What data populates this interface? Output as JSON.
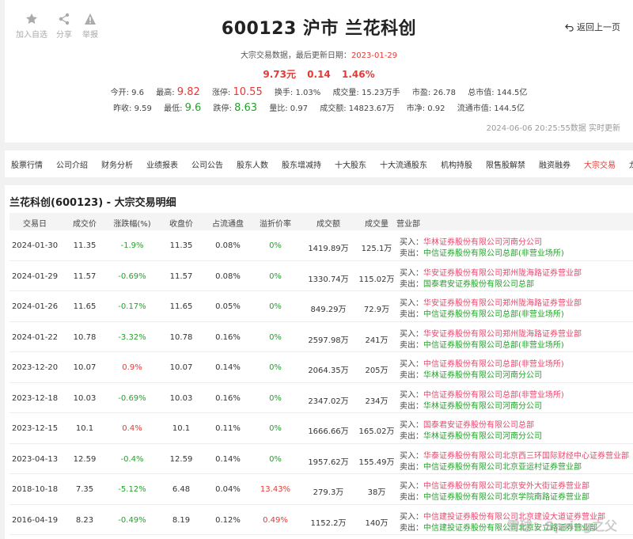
{
  "actions": [
    {
      "label": "加入自选",
      "icon": "star-icon"
    },
    {
      "label": "分享",
      "icon": "share-icon"
    },
    {
      "label": "举报",
      "icon": "warning-icon"
    }
  ],
  "title": "600123 沪市 兰花科创",
  "back_label": "返回上一页",
  "subtitle_prefix": "大宗交易数据，最后更新日期：",
  "subtitle_date": "2023-01-29",
  "price": {
    "last": "9.73元",
    "change": "0.14",
    "pct": "1.46%"
  },
  "stats_row1": [
    {
      "label": "今开:",
      "value": "9.6"
    },
    {
      "label": "最高:",
      "value": "9.82"
    },
    {
      "label": "涨停:",
      "value": "10.55"
    },
    {
      "label": "换手:",
      "value": "1.03%"
    },
    {
      "label": "成交量:",
      "value": "15.23万手"
    },
    {
      "label": "市盈:",
      "value": "26.78"
    },
    {
      "label": "总市值:",
      "value": "144.5亿"
    }
  ],
  "stats_row2": [
    {
      "label": "昨收:",
      "value": "9.59"
    },
    {
      "label": "最低:",
      "value": "9.6"
    },
    {
      "label": "跌停:",
      "value": "8.63"
    },
    {
      "label": "量比:",
      "value": "0.97"
    },
    {
      "label": "成交额:",
      "value": "14823.67万"
    },
    {
      "label": "市净:",
      "value": "0.92"
    },
    {
      "label": "流通市值:",
      "value": "144.5亿"
    }
  ],
  "updated": "2024-06-06 20:25:55数据 实时更新",
  "tabs": [
    "股票行情",
    "公司介绍",
    "财务分析",
    "业绩报表",
    "公司公告",
    "股东人数",
    "股东增减持",
    "十大股东",
    "十大流通股东",
    "机构持股",
    "限售股解禁",
    "融资融券",
    "大宗交易",
    "龙虎榜单"
  ],
  "active_tab": "大宗交易",
  "table_title": "兰花科创(600123) - 大宗交易明细",
  "columns": [
    "交易日",
    "成交价",
    "涨跌幅(%)",
    "收盘价",
    "占流通盘",
    "溢折价率",
    "成交额",
    "成交量",
    "营业部"
  ],
  "buy_label": "买入：",
  "sell_label": "卖出：",
  "rows": [
    {
      "date": "2024-01-30",
      "price": "11.35",
      "chg": "-1.9%",
      "close": "11.35",
      "float": "0.08%",
      "premium": "0%",
      "amount": "1419.89万",
      "volume": "125.1万",
      "buyer": "华林证券股份有限公司河南分公司",
      "seller": "中信证券股份有限公司总部(非营业场所)"
    },
    {
      "date": "2024-01-29",
      "price": "11.57",
      "chg": "-0.69%",
      "close": "11.57",
      "float": "0.08%",
      "premium": "0%",
      "amount": "1330.74万",
      "volume": "115.02万",
      "buyer": "华安证券股份有限公司郑州陇海路证券营业部",
      "seller": "国泰君安证券股份有限公司总部"
    },
    {
      "date": "2024-01-26",
      "price": "11.65",
      "chg": "-0.17%",
      "close": "11.65",
      "float": "0.05%",
      "premium": "0%",
      "amount": "849.29万",
      "volume": "72.9万",
      "buyer": "华安证券股份有限公司郑州陇海路证券营业部",
      "seller": "中信证券股份有限公司总部(非营业场所)"
    },
    {
      "date": "2024-01-22",
      "price": "10.78",
      "chg": "-3.32%",
      "close": "10.78",
      "float": "0.16%",
      "premium": "0%",
      "amount": "2597.98万",
      "volume": "241万",
      "buyer": "华安证券股份有限公司郑州陇海路证券营业部",
      "seller": "中信证券股份有限公司总部(非营业场所)"
    },
    {
      "date": "2023-12-20",
      "price": "10.07",
      "chg": "0.9%",
      "close": "10.07",
      "float": "0.14%",
      "premium": "0%",
      "amount": "2064.35万",
      "volume": "205万",
      "buyer": "中信证券股份有限公司总部(非营业场所)",
      "seller": "华林证券股份有限公司河南分公司"
    },
    {
      "date": "2023-12-18",
      "price": "10.03",
      "chg": "-0.69%",
      "close": "10.03",
      "float": "0.16%",
      "premium": "0%",
      "amount": "2347.02万",
      "volume": "234万",
      "buyer": "中信证券股份有限公司总部(非营业场所)",
      "seller": "华林证券股份有限公司河南分公司"
    },
    {
      "date": "2023-12-15",
      "price": "10.1",
      "chg": "0.4%",
      "close": "10.1",
      "float": "0.11%",
      "premium": "0%",
      "amount": "1666.66万",
      "volume": "165.02万",
      "buyer": "国泰君安证券股份有限公司总部",
      "seller": "华林证券股份有限公司河南分公司"
    },
    {
      "date": "2023-04-13",
      "price": "12.59",
      "chg": "-0.4%",
      "close": "12.59",
      "float": "0.14%",
      "premium": "0%",
      "amount": "1957.62万",
      "volume": "155.49万",
      "buyer": "华泰证券股份有限公司北京西三环国际财经中心证券营业部",
      "seller": "中信证券股份有限公司北京亚运村证券营业部"
    },
    {
      "date": "2018-10-18",
      "price": "7.35",
      "chg": "-5.12%",
      "close": "6.48",
      "float": "0.04%",
      "premium": "13.43%",
      "amount": "279.3万",
      "volume": "38万",
      "buyer": "中信证券股份有限公司北京安外大街证券营业部",
      "seller": "中信证券股份有限公司北京学院南路证券营业部"
    },
    {
      "date": "2016-04-19",
      "price": "8.23",
      "chg": "-0.49%",
      "close": "8.19",
      "float": "0.12%",
      "premium": "0.49%",
      "amount": "1152.2万",
      "volume": "140万",
      "buyer": "中信建投证券股份有限公司北京建设大道证券营业部",
      "seller": "中信建投证券股份有限公司北京安立路证券营业部"
    }
  ],
  "watermark": "雪球：Spring之父",
  "colors": {
    "red": "#e53935",
    "green": "#22a329",
    "pink": "#e8476d"
  }
}
